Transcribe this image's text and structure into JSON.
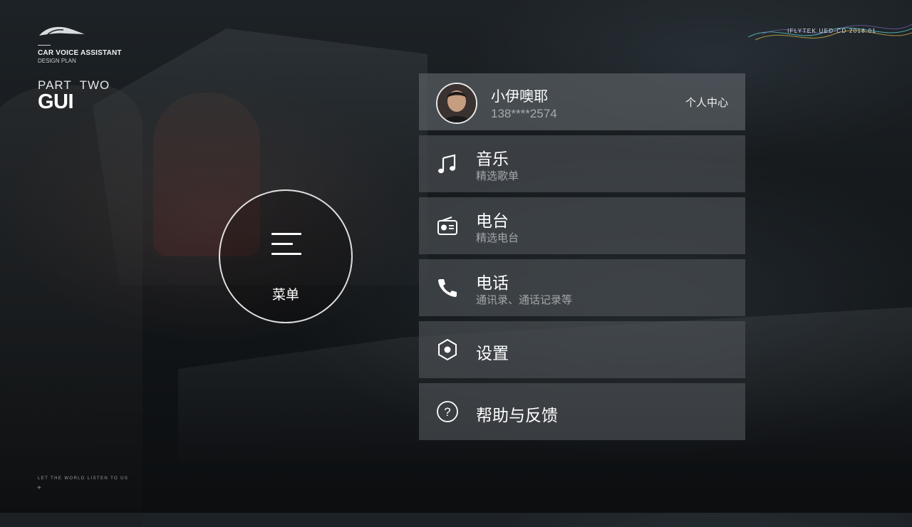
{
  "branding": {
    "logo_icon": "car-silhouette-icon",
    "title": "CAR VOICE ASSISTANT",
    "subtitle": "DESIGN PLAN",
    "part_label": "PART  TWO",
    "part_title": "GUI"
  },
  "top_right_tag": "IFLYTEK UED-CD 2018.01",
  "menu": {
    "icon": "hamburger-menu-icon",
    "label": "菜单"
  },
  "profile": {
    "avatar_icon": "user-avatar",
    "name": "小伊噢耶",
    "phone": "138****2574",
    "link_label": "个人中心"
  },
  "items": [
    {
      "icon": "music-note-icon",
      "title": "音乐",
      "subtitle": "精选歌单"
    },
    {
      "icon": "radio-icon",
      "title": "电台",
      "subtitle": "精选电台"
    },
    {
      "icon": "phone-icon",
      "title": "电话",
      "subtitle": "通讯录、通话记录等"
    },
    {
      "icon": "settings-hexagon-icon",
      "title": "设置"
    },
    {
      "icon": "help-question-icon",
      "title": "帮助与反馈"
    }
  ],
  "footer": {
    "slogan": "LET THE WORLD LISTEN TO US",
    "plus": "+"
  },
  "colors": {
    "background": "#14181b",
    "row_background": "#4b5054",
    "text_primary": "#ffffff",
    "text_secondary": "#a7abae"
  }
}
